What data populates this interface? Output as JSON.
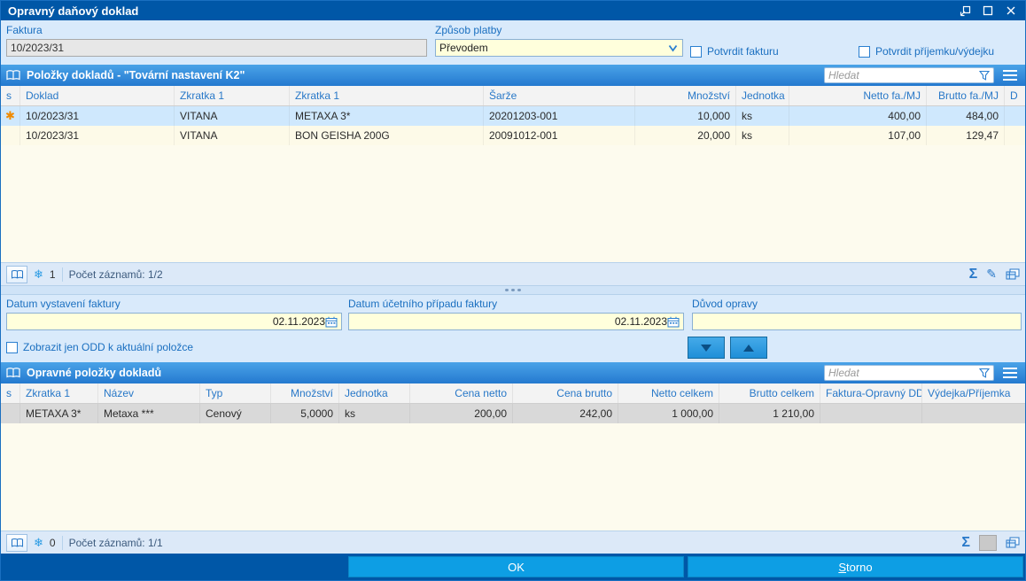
{
  "window": {
    "title": "Opravný daňový doklad"
  },
  "icons": {
    "sum": "Σ",
    "edit": "✎",
    "records_flag": "❄",
    "modified_star": "✱"
  },
  "top_form": {
    "faktura_label": "Faktura",
    "faktura_value": "10/2023/31",
    "zpusob_platby_label": "Způsob platby",
    "zpusob_platby_value": "Převodem",
    "potvrdit_fakturu_label": "Potvrdit fakturu",
    "potvrdit_prijemku_label": "Potvrdit příjemku/výdejku"
  },
  "grid1": {
    "title": "Položky dokladů - \"Tovární nastavení K2\"",
    "search_placeholder": "Hledat",
    "columns": [
      "s",
      "Doklad",
      "Zkratka 1",
      "Zkratka 1",
      "Šarže",
      "Množství",
      "Jednotka",
      "Netto fa./MJ",
      "Brutto fa./MJ",
      "D"
    ],
    "rows": [
      [
        "✱",
        "10/2023/31",
        "VITANA",
        "METAXA 3*",
        "20201203-001",
        "10,000",
        "ks",
        "400,00",
        "484,00",
        ""
      ],
      [
        "",
        "10/2023/31",
        "VITANA",
        "BON GEISHA 200G",
        "20091012-001",
        "20,000",
        "ks",
        "107,00",
        "129,47",
        ""
      ]
    ],
    "footer": {
      "flag_count": "1",
      "records": "Počet záznamů: 1/2"
    }
  },
  "mid_form": {
    "datum_vystaveni_label": "Datum vystavení faktury",
    "datum_vystaveni_value": "02.11.2023",
    "datum_ucetni_label": "Datum účetního případu faktury",
    "datum_ucetni_value": "02.11.2023",
    "duvod_label": "Důvod opravy",
    "duvod_value": "",
    "zobrazit_odd_label": "Zobrazit jen ODD k aktuální položce"
  },
  "grid2": {
    "title": "Opravné položky dokladů",
    "search_placeholder": "Hledat",
    "columns": [
      "s",
      "Zkratka 1",
      "Název",
      "Typ",
      "Množství",
      "Jednotka",
      "Cena netto",
      "Cena brutto",
      "Netto celkem",
      "Brutto celkem",
      "Faktura-Opravný DD",
      "Výdejka/Příjemka"
    ],
    "rows": [
      [
        "",
        "METAXA 3*",
        "Metaxa ***",
        "Cenový",
        "5,0000",
        "ks",
        "200,00",
        "242,00",
        "1 000,00",
        "1 210,00",
        "",
        ""
      ]
    ],
    "footer": {
      "flag_count": "0",
      "records": "Počet záznamů: 1/1"
    }
  },
  "actions": {
    "ok": "OK",
    "storno": "Storno"
  }
}
